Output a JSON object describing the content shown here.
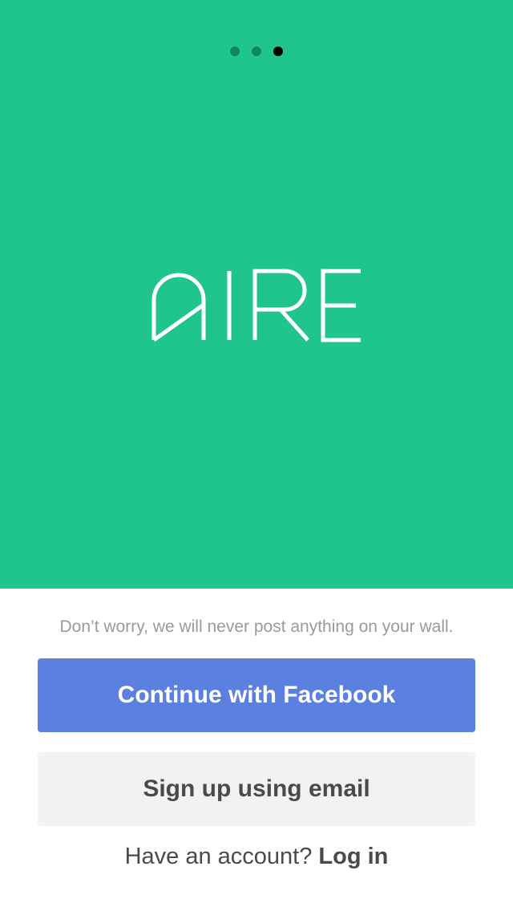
{
  "pager": {
    "pages": 3,
    "active_index": 2
  },
  "brand": {
    "logo_text": "AIRE",
    "background_color": "#20c58b"
  },
  "bottom": {
    "disclaimer": "Don’t worry, we will never post anything on your wall.",
    "facebook_button_label": "Continue with Facebook",
    "facebook_button_color": "#5b80df",
    "email_button_label": "Sign up using email",
    "login_prompt": "Have an account?",
    "login_link": "Log in"
  }
}
